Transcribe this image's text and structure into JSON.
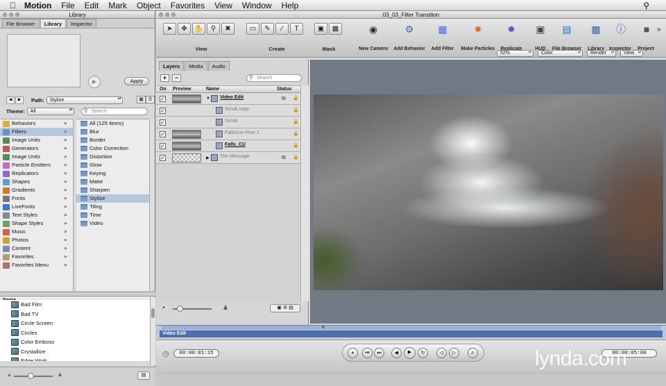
{
  "menubar": {
    "app": "Motion",
    "items": [
      "File",
      "Edit",
      "Mark",
      "Object",
      "Favorites",
      "View",
      "Window",
      "Help"
    ]
  },
  "library": {
    "title": "Library",
    "tabs": [
      "File Browser",
      "Library",
      "Inspector"
    ],
    "apply": "Apply",
    "path_label": "Path:",
    "path_value": "Stylize",
    "theme_label": "Theme:",
    "theme_value": "All",
    "search_placeholder": "Search",
    "categories": [
      {
        "label": "Behaviors",
        "color": "#d9b04a"
      },
      {
        "label": "Filters",
        "color": "#6c8fc8"
      },
      {
        "label": "Image Units",
        "color": "#5a8a5a"
      },
      {
        "label": "Generators",
        "color": "#c05a5a"
      },
      {
        "label": "Image Units",
        "color": "#5a8a5a"
      },
      {
        "label": "Particle Emitters",
        "color": "#c56bbd"
      },
      {
        "label": "Replicators",
        "color": "#8a6bc5"
      },
      {
        "label": "Shapes",
        "color": "#5aa0c8"
      },
      {
        "label": "Gradients",
        "color": "#d07a3a"
      },
      {
        "label": "Fonts",
        "color": "#777777"
      },
      {
        "label": "LiveFonts",
        "color": "#3a78c8"
      },
      {
        "label": "Text Styles",
        "color": "#888888"
      },
      {
        "label": "Shape Styles",
        "color": "#6aa06a"
      },
      {
        "label": "Music",
        "color": "#c86060"
      },
      {
        "label": "Photos",
        "color": "#caa040"
      },
      {
        "label": "Content",
        "color": "#7a8ab0"
      },
      {
        "label": "Favorites",
        "color": "#b0a070"
      },
      {
        "label": "Favorites Menu",
        "color": "#b07070"
      }
    ],
    "subcategories": [
      "All (125 items)",
      "Blur",
      "Border",
      "Color Correction",
      "Distortion",
      "Glow",
      "Keying",
      "Matte",
      "Sharpen",
      "Stylize",
      "Tiling",
      "Time",
      "Video"
    ],
    "selected_sub": "Stylize",
    "list_header": "Name",
    "files": [
      "Bad Film",
      "Bad TV",
      "Circle Screen",
      "Circles",
      "Color Emboss",
      "Crystallize",
      "Edge Work"
    ]
  },
  "window": {
    "title": "03_03_Filter Transition"
  },
  "toolbar": {
    "groups": [
      {
        "label": "View"
      },
      {
        "label": "Create"
      },
      {
        "label": "Mask"
      }
    ],
    "buttons": [
      "New Camera",
      "Add Behavior",
      "Add Filter",
      "Make Particles",
      "Replicate",
      "HUD",
      "File Browser",
      "Library",
      "Inspector",
      "Project"
    ]
  },
  "canvas_bar": {
    "zoom": "52%",
    "color": "Color",
    "render": "Render",
    "view": "View"
  },
  "layers": {
    "tabs": [
      "Layers",
      "Media",
      "Audio"
    ],
    "search_placeholder": "Search",
    "headers": {
      "on": "On",
      "preview": "Preview",
      "name": "Name",
      "status": "Status"
    },
    "rows": [
      {
        "name": "Video Edit",
        "bold": true
      },
      {
        "name": "Scrub copy",
        "bold": false
      },
      {
        "name": "Scrub",
        "bold": false
      },
      {
        "name": "FallsSun-Prox 1",
        "bold": false
      },
      {
        "name": "Falls_CU",
        "bold": true
      },
      {
        "name": "The Message",
        "bold": false
      }
    ]
  },
  "timeline": {
    "clip": "Video Edit"
  },
  "transport": {
    "current_time": "00:00:01:15",
    "duration": "00:00:05:00"
  },
  "watermark": "lynda.com"
}
